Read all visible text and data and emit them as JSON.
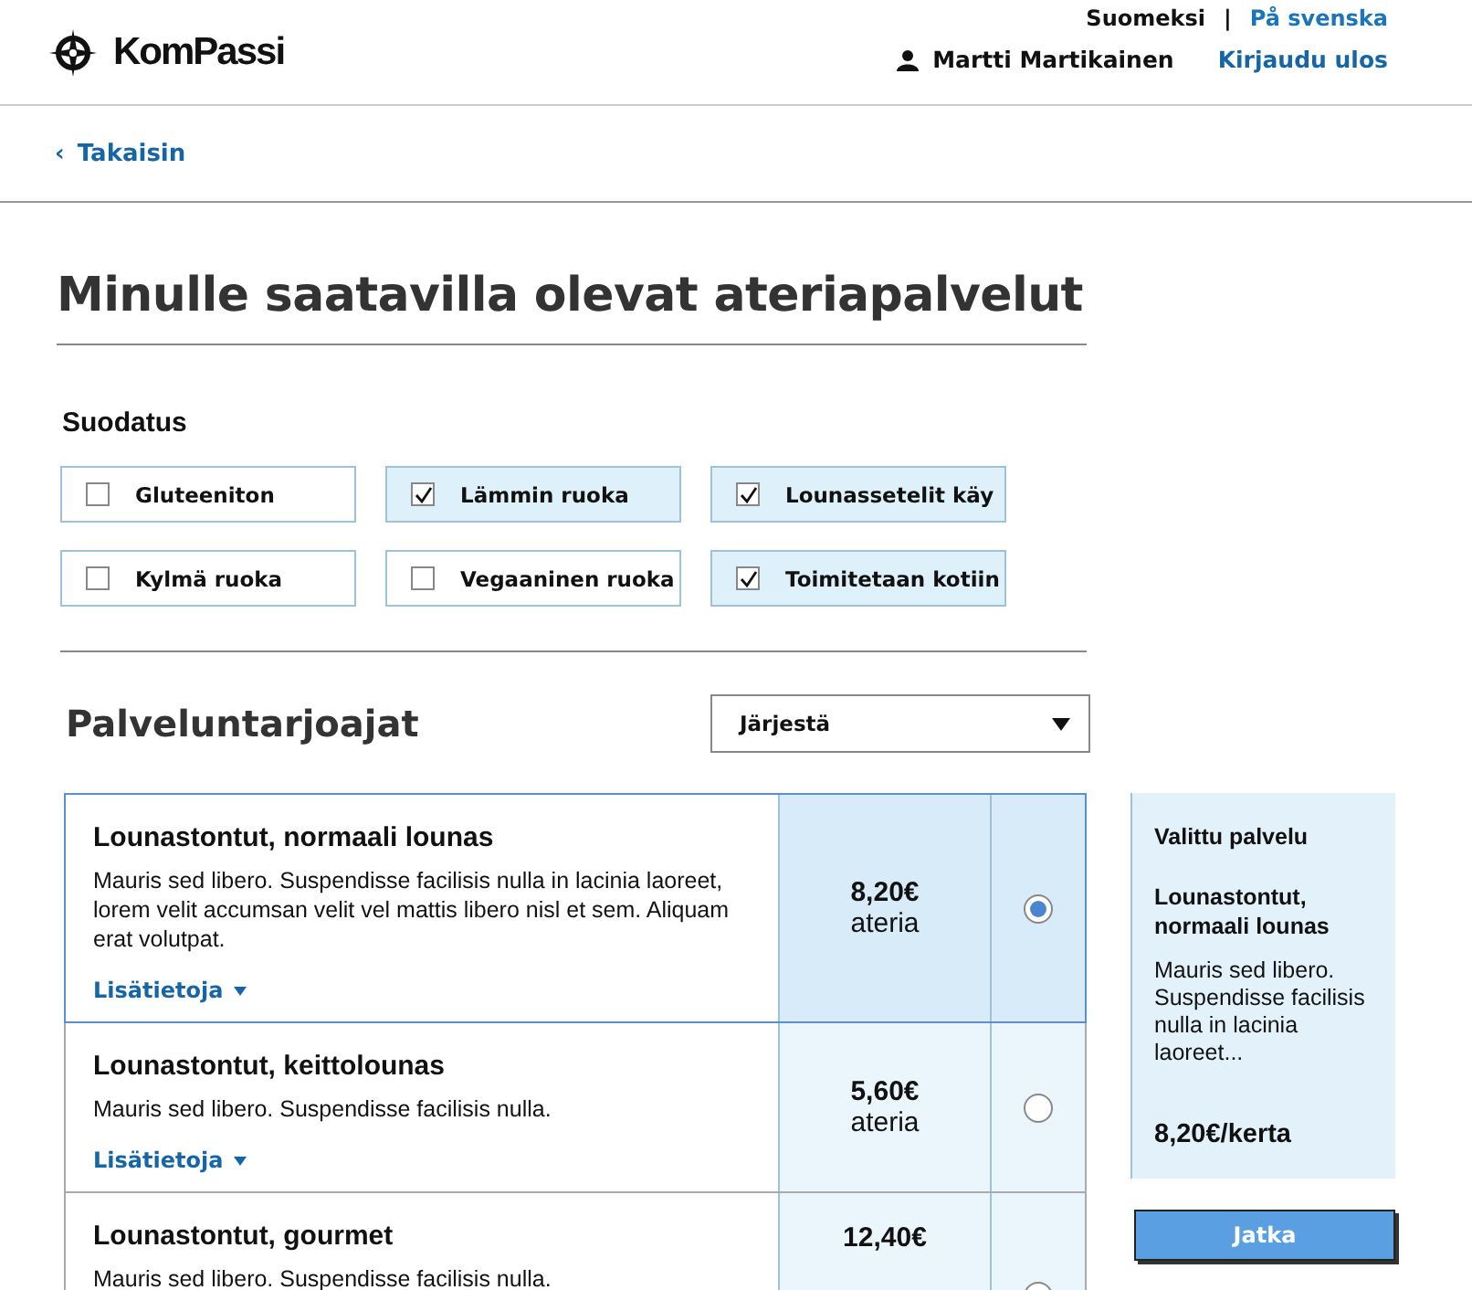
{
  "header": {
    "brand": "KomPassi",
    "languages": [
      {
        "label": "Suomeksi",
        "selected": true
      },
      {
        "label": "På svenska",
        "selected": false
      }
    ],
    "separator": "|",
    "user": "Martti Martikainen",
    "logout": "Kirjaudu ulos"
  },
  "back_link": {
    "icon": "‹",
    "label": "Takaisin"
  },
  "title": "Minulle saatavilla olevat ateriapalvelut",
  "filters": {
    "heading": "Suodatus",
    "items": [
      {
        "label": "Gluteeniton",
        "checked": false
      },
      {
        "label": "Lämmin ruoka",
        "checked": true
      },
      {
        "label": "Lounassetelit käy",
        "checked": true
      },
      {
        "label": "Kylmä ruoka",
        "checked": false
      },
      {
        "label": "Vegaaninen ruoka",
        "checked": false
      },
      {
        "label": "Toimitetaan kotiin",
        "checked": true
      }
    ]
  },
  "providers": {
    "heading": "Palveluntarjoajat",
    "sort": {
      "value": "Järjestä"
    },
    "rows": [
      {
        "name": "Lounastontut, normaali lounas",
        "description": "Mauris sed libero. Suspendisse facilisis nulla in lacinia laoreet, lorem velit accumsan velit vel mattis libero nisl et sem. Aliquam erat volutpat.",
        "more": "Lisätietoja",
        "price": "8,20€",
        "unit": "ateria",
        "selected": true
      },
      {
        "name": "Lounastontut, keittolounas",
        "description": "Mauris sed libero. Suspendisse facilisis nulla.",
        "more": "Lisätietoja",
        "price": "5,60€",
        "unit": "ateria",
        "selected": false
      },
      {
        "name": "Lounastontut, gourmet",
        "description": "Mauris sed libero. Suspendisse facilisis nulla.",
        "price": "12,40€",
        "selected": false
      }
    ]
  },
  "summary": {
    "heading": "Valittu palvelu",
    "name": "Lounastontut, normaali lounas",
    "description": "Mauris sed libero. Suspendisse facilisis nulla in lacinia laoreet...",
    "price": "8,20€/kerta"
  },
  "continue_button": "Jatka"
}
